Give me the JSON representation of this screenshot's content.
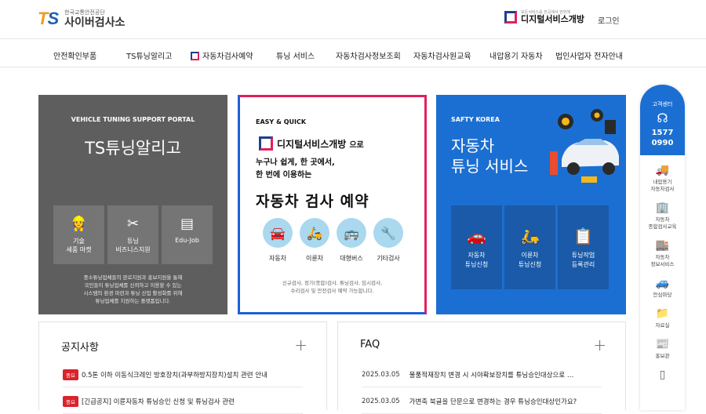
{
  "header": {
    "logo_mark": "TS",
    "logo_sub": "한국교통안전공단",
    "logo_main": "사이버검사소",
    "ds_small": "모든서비스를 한곳에서 한번에",
    "ds_label": "디지털서비스개방",
    "login": "로그인"
  },
  "nav": [
    "안전확인부품",
    "TS튜닝알리고",
    "자동차검사예약",
    "튜닝 서비스",
    "자동차검사정보조회",
    "자동차검사원교육",
    "내압용기 자동차",
    "법인사업자 전자안내"
  ],
  "card1": {
    "sub": "VEHICLE TUNING SUPPORT PORTAL",
    "title": "TS튜닝알리고",
    "tiles": [
      {
        "icon": "mechanic-icon",
        "glyph": "👷",
        "label": "기술\n세품 마켓"
      },
      {
        "icon": "tools-icon",
        "glyph": "✂",
        "label": "튜닝\n비즈니스지원"
      },
      {
        "icon": "document-icon",
        "glyph": "▤",
        "label": "Edu-Job"
      }
    ],
    "desc": "중소튜닝업체들의 판로지원과 홍보지원을 통해\n국민들이 튜닝업체를 신뢰하고 이용할 수 있는\n시스템의 환경 마련과 튜닝 산업 활성화를 위해\n튜닝업체를 지원하는 플랫폼입니다."
  },
  "card2": {
    "sub": "EASY & QUICK",
    "ds_label": "디지털서비스개방",
    "ds_suffix": "으로",
    "line1": "누구나 쉽게, 한 곳에서,",
    "line2": "한 번에 이용하는",
    "title": "자동차 검사 예약",
    "icons": [
      {
        "icon": "car-icon",
        "glyph": "🚘",
        "label": "자동차"
      },
      {
        "icon": "motorcycle-icon",
        "glyph": "🛵",
        "label": "이륜차"
      },
      {
        "icon": "bus-icon",
        "glyph": "🚌",
        "label": "대형버스"
      },
      {
        "icon": "wrench-icon",
        "glyph": "🔧",
        "label": "기타검사"
      }
    ],
    "desc": "신규검사, 정기(종합)검사, 튜닝검사, 임시검사,\n수리검사 및 안전검사 예약 가능합니다."
  },
  "card3": {
    "sub": "SAFTY KOREA",
    "title1": "자동차",
    "title2": "튜닝 서비스",
    "tiles": [
      {
        "icon": "car-gear-icon",
        "glyph": "🚗",
        "label": "자동차\n튜닝신청"
      },
      {
        "icon": "scooter-icon",
        "glyph": "🛵",
        "label": "이륜차\n튜닝신청"
      },
      {
        "icon": "clipboard-icon",
        "glyph": "📋",
        "label": "튜닝작업\n등록관리"
      }
    ]
  },
  "notice": {
    "title": "공지사항",
    "plus": "+",
    "rows": [
      {
        "badge": "중요",
        "text": "0.5톤 이하 이동식크레인 방호장치(과부하방지장치)설치 관련 안내"
      },
      {
        "badge": "중요",
        "text": "[긴급공지] 이륜자동차 튜닝승인 신청 및 튜닝검사 관련"
      }
    ]
  },
  "faq": {
    "title": "FAQ",
    "plus": "+",
    "rows": [
      {
        "date": "2025.03.05",
        "text": "물품적재장치 변경 시 시야확보장치를 튜닝승인대상으로 …"
      },
      {
        "date": "2025.03.05",
        "text": "가변축 북글을 단문으로 변경하는 경우 튜닝승인대상인가요?"
      }
    ]
  },
  "side": {
    "label": "고객센터",
    "phone1": "1577",
    "phone2": "0990",
    "items": [
      {
        "icon": "truck-icon",
        "glyph": "🚚",
        "label": "내압용기\n자동차검사"
      },
      {
        "icon": "building-icon",
        "glyph": "🏢",
        "label": "자동차\n종합검사교육"
      },
      {
        "icon": "info-icon",
        "glyph": "🏬",
        "label": "자동차\n정보서비스"
      },
      {
        "icon": "square-icon",
        "glyph": "🚙",
        "label": "안심마당"
      },
      {
        "icon": "folder-icon",
        "glyph": "📁",
        "label": "자료실"
      },
      {
        "icon": "news-icon",
        "glyph": "📰",
        "label": "홍보관"
      },
      {
        "icon": "doc-icon",
        "glyph": "▯",
        "label": ""
      }
    ]
  },
  "colors": {
    "brand_blue": "#1c6fd2",
    "accent_red": "#e2205a",
    "gray_card": "#5e5e5e"
  }
}
